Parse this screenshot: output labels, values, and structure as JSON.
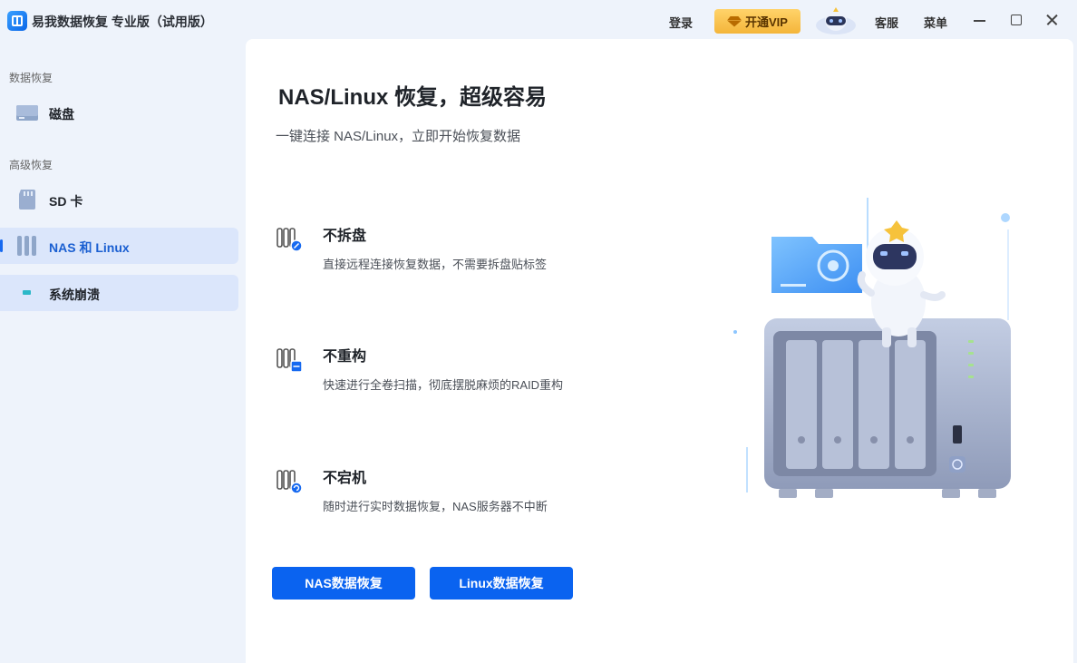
{
  "titlebar": {
    "app_title": "易我数据恢复 专业版（试用版）",
    "login": "登录",
    "vip": "开通VIP",
    "service": "客服",
    "menu": "菜单"
  },
  "sidebar": {
    "section_data": "数据恢复",
    "section_advanced": "高级恢复",
    "items": [
      {
        "label": "磁盘",
        "icon": "disk-icon"
      },
      {
        "label": "SD 卡",
        "icon": "sd-card-icon"
      },
      {
        "label": "NAS 和 Linux",
        "icon": "nas-icon",
        "active": true
      },
      {
        "label": "系统崩溃",
        "icon": "system-crash-icon"
      }
    ]
  },
  "main": {
    "title": "NAS/Linux 恢复，超级容易",
    "subtitle": "一键连接 NAS/Linux，立即开始恢复数据",
    "features": [
      {
        "title": "不拆盘",
        "desc": "直接远程连接恢复数据，不需要拆盘贴标签"
      },
      {
        "title": "不重构",
        "desc": "快速进行全卷扫描，彻底摆脱麻烦的RAID重构"
      },
      {
        "title": "不宕机",
        "desc": "随时进行实时数据恢复，NAS服务器不中断"
      }
    ],
    "btn_nas": "NAS数据恢复",
    "btn_linux": "Linux数据恢复"
  },
  "colors": {
    "accent": "#0a63f0",
    "sidebar_bg": "#eef3fb",
    "active_item_bg": "#dbe6fb",
    "vip_gold": "#f4b53a"
  }
}
